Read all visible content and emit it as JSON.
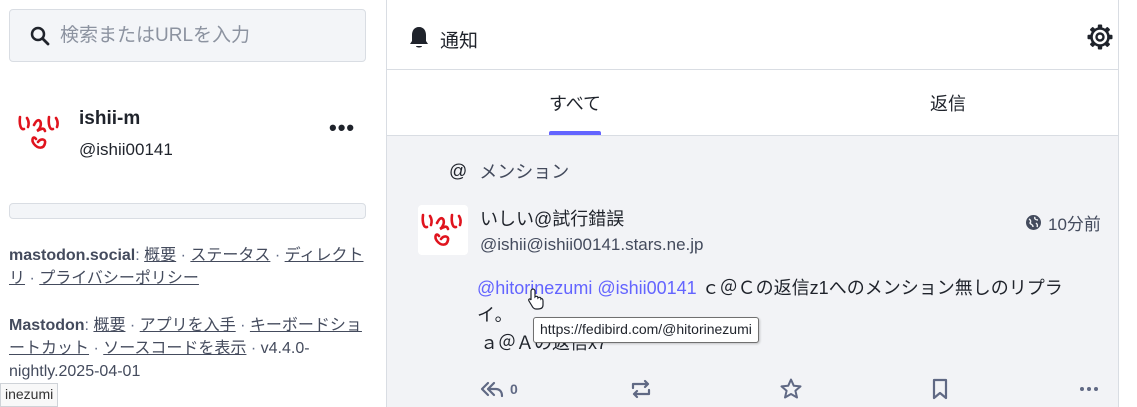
{
  "search": {
    "placeholder": "検索またはURLを入力"
  },
  "account": {
    "display_name": "ishii-m",
    "handle": "@ishii00141",
    "more_label": "•••"
  },
  "footer": {
    "server": "mastodon.social",
    "server_links": [
      "概要",
      "ステータス",
      "ディレクトリ",
      "プライバシーポリシー"
    ],
    "app": "Mastodon",
    "app_links": [
      "概要",
      "アプリを入手",
      "キーボードショートカット",
      "ソースコードを表示"
    ],
    "version": "v4.4.0-nightly.2025-04-01"
  },
  "left_tooltip": "inezumi",
  "column": {
    "title": "通知"
  },
  "tabs": [
    {
      "label": "すべて"
    },
    {
      "label": "返信"
    }
  ],
  "notification": {
    "type_label": "メンション",
    "status": {
      "display_name": "いしい@試行錯誤",
      "acct": "@ishii@ishii00141.stars.ne.jp",
      "time": "10分前",
      "mentions": [
        "@hitorinezumi",
        "@ishii00141"
      ],
      "text": "ｃ＠Ｃの返信z1へのメンション無しのリプライ。",
      "text2": "ａ＠Ａの返信x7"
    },
    "link_tooltip": "https://fedibird.com/@hitorinezumi",
    "reply_count": "0"
  },
  "colors": {
    "accent": "#6364ff",
    "avatar_red": "#e0141e"
  }
}
